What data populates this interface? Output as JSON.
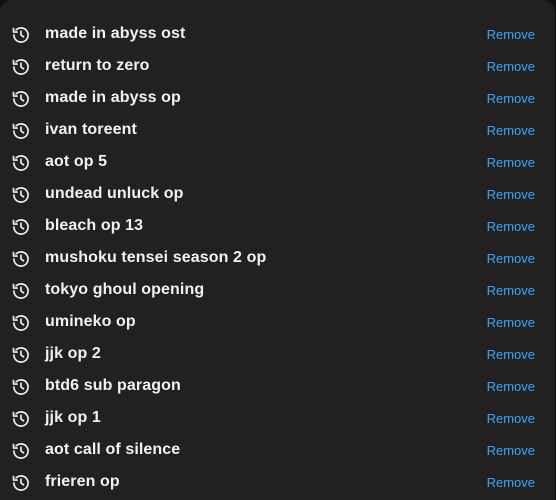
{
  "history": {
    "remove_label": "Remove",
    "icon": "history-icon",
    "items": [
      {
        "query": "made in abyss ost"
      },
      {
        "query": "return to zero"
      },
      {
        "query": "made in abyss op"
      },
      {
        "query": "ivan toreent"
      },
      {
        "query": "aot op 5"
      },
      {
        "query": "undead unluck op"
      },
      {
        "query": "bleach op 13"
      },
      {
        "query": "mushoku tensei season 2 op"
      },
      {
        "query": "tokyo ghoul opening"
      },
      {
        "query": "umineko op"
      },
      {
        "query": "jjk op 2"
      },
      {
        "query": "btd6 sub paragon"
      },
      {
        "query": "jjk op 1"
      },
      {
        "query": "aot call of silence"
      },
      {
        "query": "frieren op"
      }
    ]
  },
  "colors": {
    "panel_bg": "#212121",
    "text": "#f1f1f1",
    "link": "#3ea6ff",
    "icon": "#f1f1f1"
  }
}
